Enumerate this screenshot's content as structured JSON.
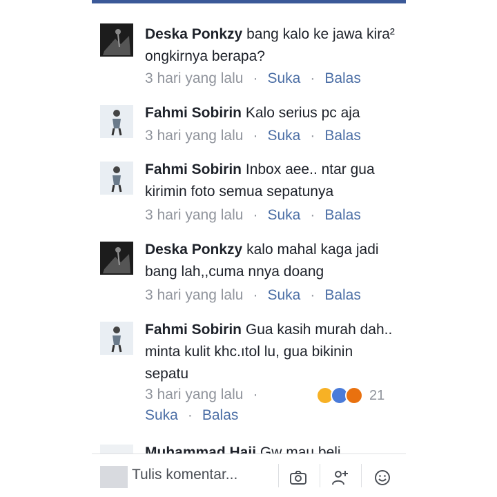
{
  "comments": [
    {
      "name": "Deska Ponkzy",
      "text": "bang kalo ke jawa kira² ongkirnya berapa?",
      "time": "3 hari yang lalu",
      "like": "Suka",
      "reply": "Balas"
    },
    {
      "name": "Fahmi Sobirin",
      "text": "Kalo serius pc aja",
      "time": "3 hari yang lalu",
      "like": "Suka",
      "reply": "Balas"
    },
    {
      "name": "Fahmi Sobirin",
      "text": "Inbox aee.. ntar gua kirimin foto semua sepatunya",
      "time": "3 hari yang lalu",
      "like": "Suka",
      "reply": "Balas"
    },
    {
      "name": "Deska Ponkzy",
      "text": "kalo mahal kaga jadi bang lah,,cuma nnya doang",
      "time": "3 hari yang lalu",
      "like": "Suka",
      "reply": "Balas"
    },
    {
      "name": "Fahmi Sobirin",
      "text": "Gua kasih murah dah.. minta kulit khc.ıtol lu, gua bikinin sepatu",
      "time": "3 hari yang lalu",
      "like": "Suka",
      "reply": "Balas",
      "reaction_count": "21"
    },
    {
      "name": "Muhammad Haji",
      "text": "Gw mau beli"
    }
  ],
  "composer": {
    "placeholder": "Tulis komentar..."
  },
  "icons": {
    "camera": "camera-icon",
    "tag": "tag-friend-icon",
    "emoji": "emoji-icon"
  },
  "colors": {
    "link": "#4b6ea5",
    "meta": "#90949c",
    "brand": "#3b5998"
  }
}
